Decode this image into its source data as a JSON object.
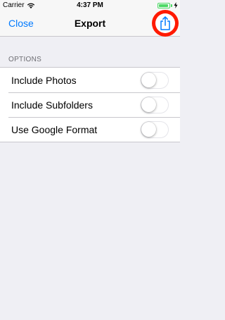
{
  "status_bar": {
    "carrier": "Carrier",
    "time": "4:37 PM",
    "battery_level": 0.95
  },
  "nav": {
    "close_label": "Close",
    "title": "Export",
    "share_icon": "share-icon"
  },
  "options": {
    "header": "OPTIONS",
    "items": [
      {
        "label": "Include Photos",
        "enabled": false
      },
      {
        "label": "Include Subfolders",
        "enabled": false
      },
      {
        "label": "Use Google Format",
        "enabled": false
      }
    ]
  },
  "colors": {
    "accent": "#007aff",
    "highlight_ring": "#ff1a00",
    "battery": "#4cd964",
    "background": "#efeff4"
  }
}
